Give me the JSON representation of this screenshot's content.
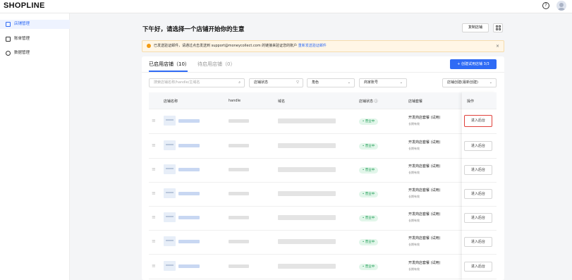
{
  "header": {
    "logo": "SHOPLINE",
    "help_glyph": "?"
  },
  "sidebar": {
    "items": [
      {
        "label": "店铺管理",
        "icon": "store-icon",
        "active": true
      },
      {
        "label": "账单管理",
        "icon": "bill-icon",
        "active": false
      },
      {
        "label": "数据管理",
        "icon": "data-icon",
        "active": false
      }
    ]
  },
  "main": {
    "title": "下午好，请选择一个店铺开始你的生意",
    "copy_button": "复制店铺",
    "notice": {
      "text": "已发送验证邮件，请通过点击发送到 support@moneycollect.com 的链接来验证您的账户",
      "link": "重新发送验证邮件",
      "close": "×"
    },
    "tabs": [
      {
        "label": "已启用店铺（10）"
      },
      {
        "label": "待启用店铺（0）"
      }
    ],
    "create_button": "+ 创建试用店铺 3/3",
    "filters": {
      "search_placeholder": "搜索店铺名称/handle/主域名",
      "status": "店铺状态",
      "role": "角色",
      "account": "商家账号",
      "sort": "店铺创建(最新创建)"
    },
    "columns": {
      "name": "店铺名称",
      "handle": "handle",
      "domain": "域名",
      "status": "店铺状态 ⓘ",
      "plan": "店铺套餐",
      "action": "操作"
    },
    "rows": [
      {
        "status": "• 营业中",
        "plan": "开发商店套餐 (试用)",
        "plan_sub": "长期有效",
        "action": "进入后台"
      },
      {
        "status": "• 营业中",
        "plan": "开发商店套餐 (试用)",
        "plan_sub": "长期有效",
        "action": "进入后台"
      },
      {
        "status": "• 营业中",
        "plan": "开发商店套餐 (试用)",
        "plan_sub": "长期有效",
        "action": "进入后台"
      },
      {
        "status": "• 营业中",
        "plan": "开发商店套餐 (试用)",
        "plan_sub": "长期有效",
        "action": "进入后台"
      },
      {
        "status": "• 营业中",
        "plan": "开发商店套餐 (试用)",
        "plan_sub": "长期有效",
        "action": "进入后台"
      },
      {
        "status": "• 营业中",
        "plan": "开发商店套餐 (试用)",
        "plan_sub": "长期有效",
        "action": "进入后台"
      },
      {
        "status": "• 营业中",
        "plan": "开发商店套餐 (试用)",
        "plan_sub": "长期有效",
        "action": "进入后台"
      }
    ]
  },
  "colors": {
    "accent": "#2f6bf5",
    "warning": "#f39b12",
    "success": "#1f9d55",
    "highlight": "#e0413b"
  }
}
